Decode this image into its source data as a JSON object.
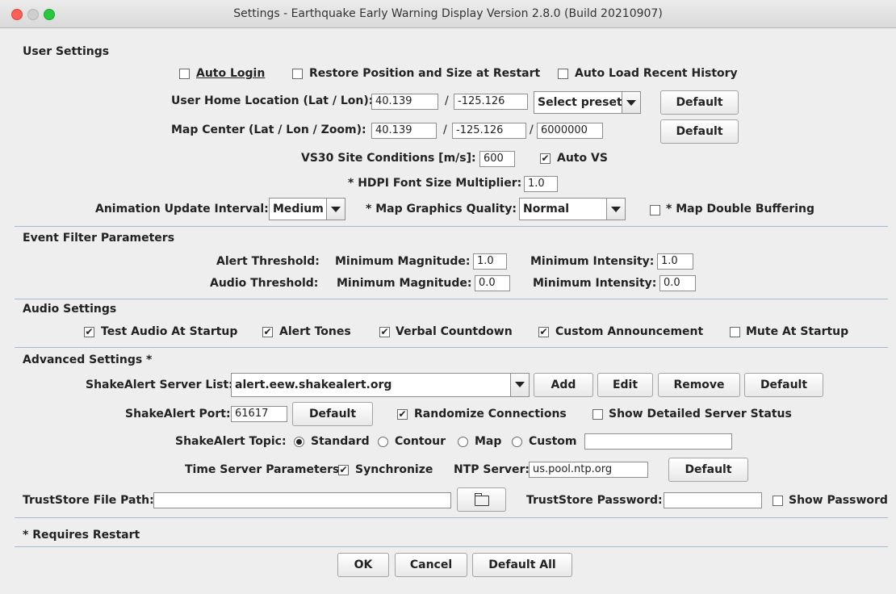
{
  "window": {
    "title": "Settings - Earthquake Early Warning Display Version 2.8.0 (Build 20210907)"
  },
  "user": {
    "heading": "User Settings",
    "auto_login": "Auto Login",
    "restore": "Restore Position and Size at Restart",
    "auto_load": "Auto Load Recent History",
    "home_label": "User Home Location (Lat / Lon):",
    "home_lat": "40.139",
    "home_lon": "-125.126",
    "preset": "Select preset",
    "default": "Default",
    "map_label": "Map Center (Lat / Lon / Zoom):",
    "map_lat": "40.139",
    "map_lon": "-125.126",
    "map_zoom": "6000000",
    "slash": "/",
    "vs30_label": "VS30 Site Conditions [m/s]:",
    "vs30": "600",
    "auto_vs": "Auto VS",
    "hdpi_label": "* HDPI Font Size Multiplier:",
    "hdpi": "1.0",
    "anim_label": "Animation Update Interval:",
    "anim": "Medium",
    "quality_label": "* Map Graphics Quality:",
    "quality": "Normal",
    "double_buffer": "* Map Double Buffering"
  },
  "filter": {
    "heading": "Event Filter Parameters",
    "alert_label": "Alert Threshold:",
    "audio_label": "Audio Threshold:",
    "min_mag": "Minimum Magnitude:",
    "min_int": "Minimum Intensity:",
    "alert_mag": "1.0",
    "alert_int": "1.0",
    "audio_mag": "0.0",
    "audio_int": "0.0"
  },
  "audio": {
    "heading": "Audio Settings",
    "test": "Test Audio At Startup",
    "tones": "Alert Tones",
    "verbal": "Verbal Countdown",
    "custom": "Custom Announcement",
    "mute": "Mute At Startup"
  },
  "advanced": {
    "heading": "Advanced Settings *",
    "server_label": "ShakeAlert Server List:",
    "server": "alert.eew.shakealert.org",
    "add": "Add",
    "edit": "Edit",
    "remove": "Remove",
    "default": "Default",
    "port_label": "ShakeAlert Port:",
    "port": "61617",
    "randomize": "Randomize Connections",
    "detailed": "Show Detailed Server Status",
    "topic_label": "ShakeAlert Topic:",
    "standard": "Standard",
    "contour": "Contour",
    "map": "Map",
    "custom": "Custom",
    "time_label": "Time Server Parameters:",
    "sync": "Synchronize",
    "ntp_label": "NTP Server:",
    "ntp": "us.pool.ntp.org",
    "trust_label": "TrustStore File Path:",
    "trust_pw_label": "TrustStore Password:",
    "show_pw": "Show Password"
  },
  "footer": {
    "note": "* Requires Restart",
    "ok": "OK",
    "cancel": "Cancel",
    "default_all": "Default All"
  },
  "check_mark": "✔",
  "colors": {
    "close": "#fc5f57",
    "minimize": "#c7c7c7",
    "zoom": "#29c840",
    "separator": "#a8b8cc"
  }
}
